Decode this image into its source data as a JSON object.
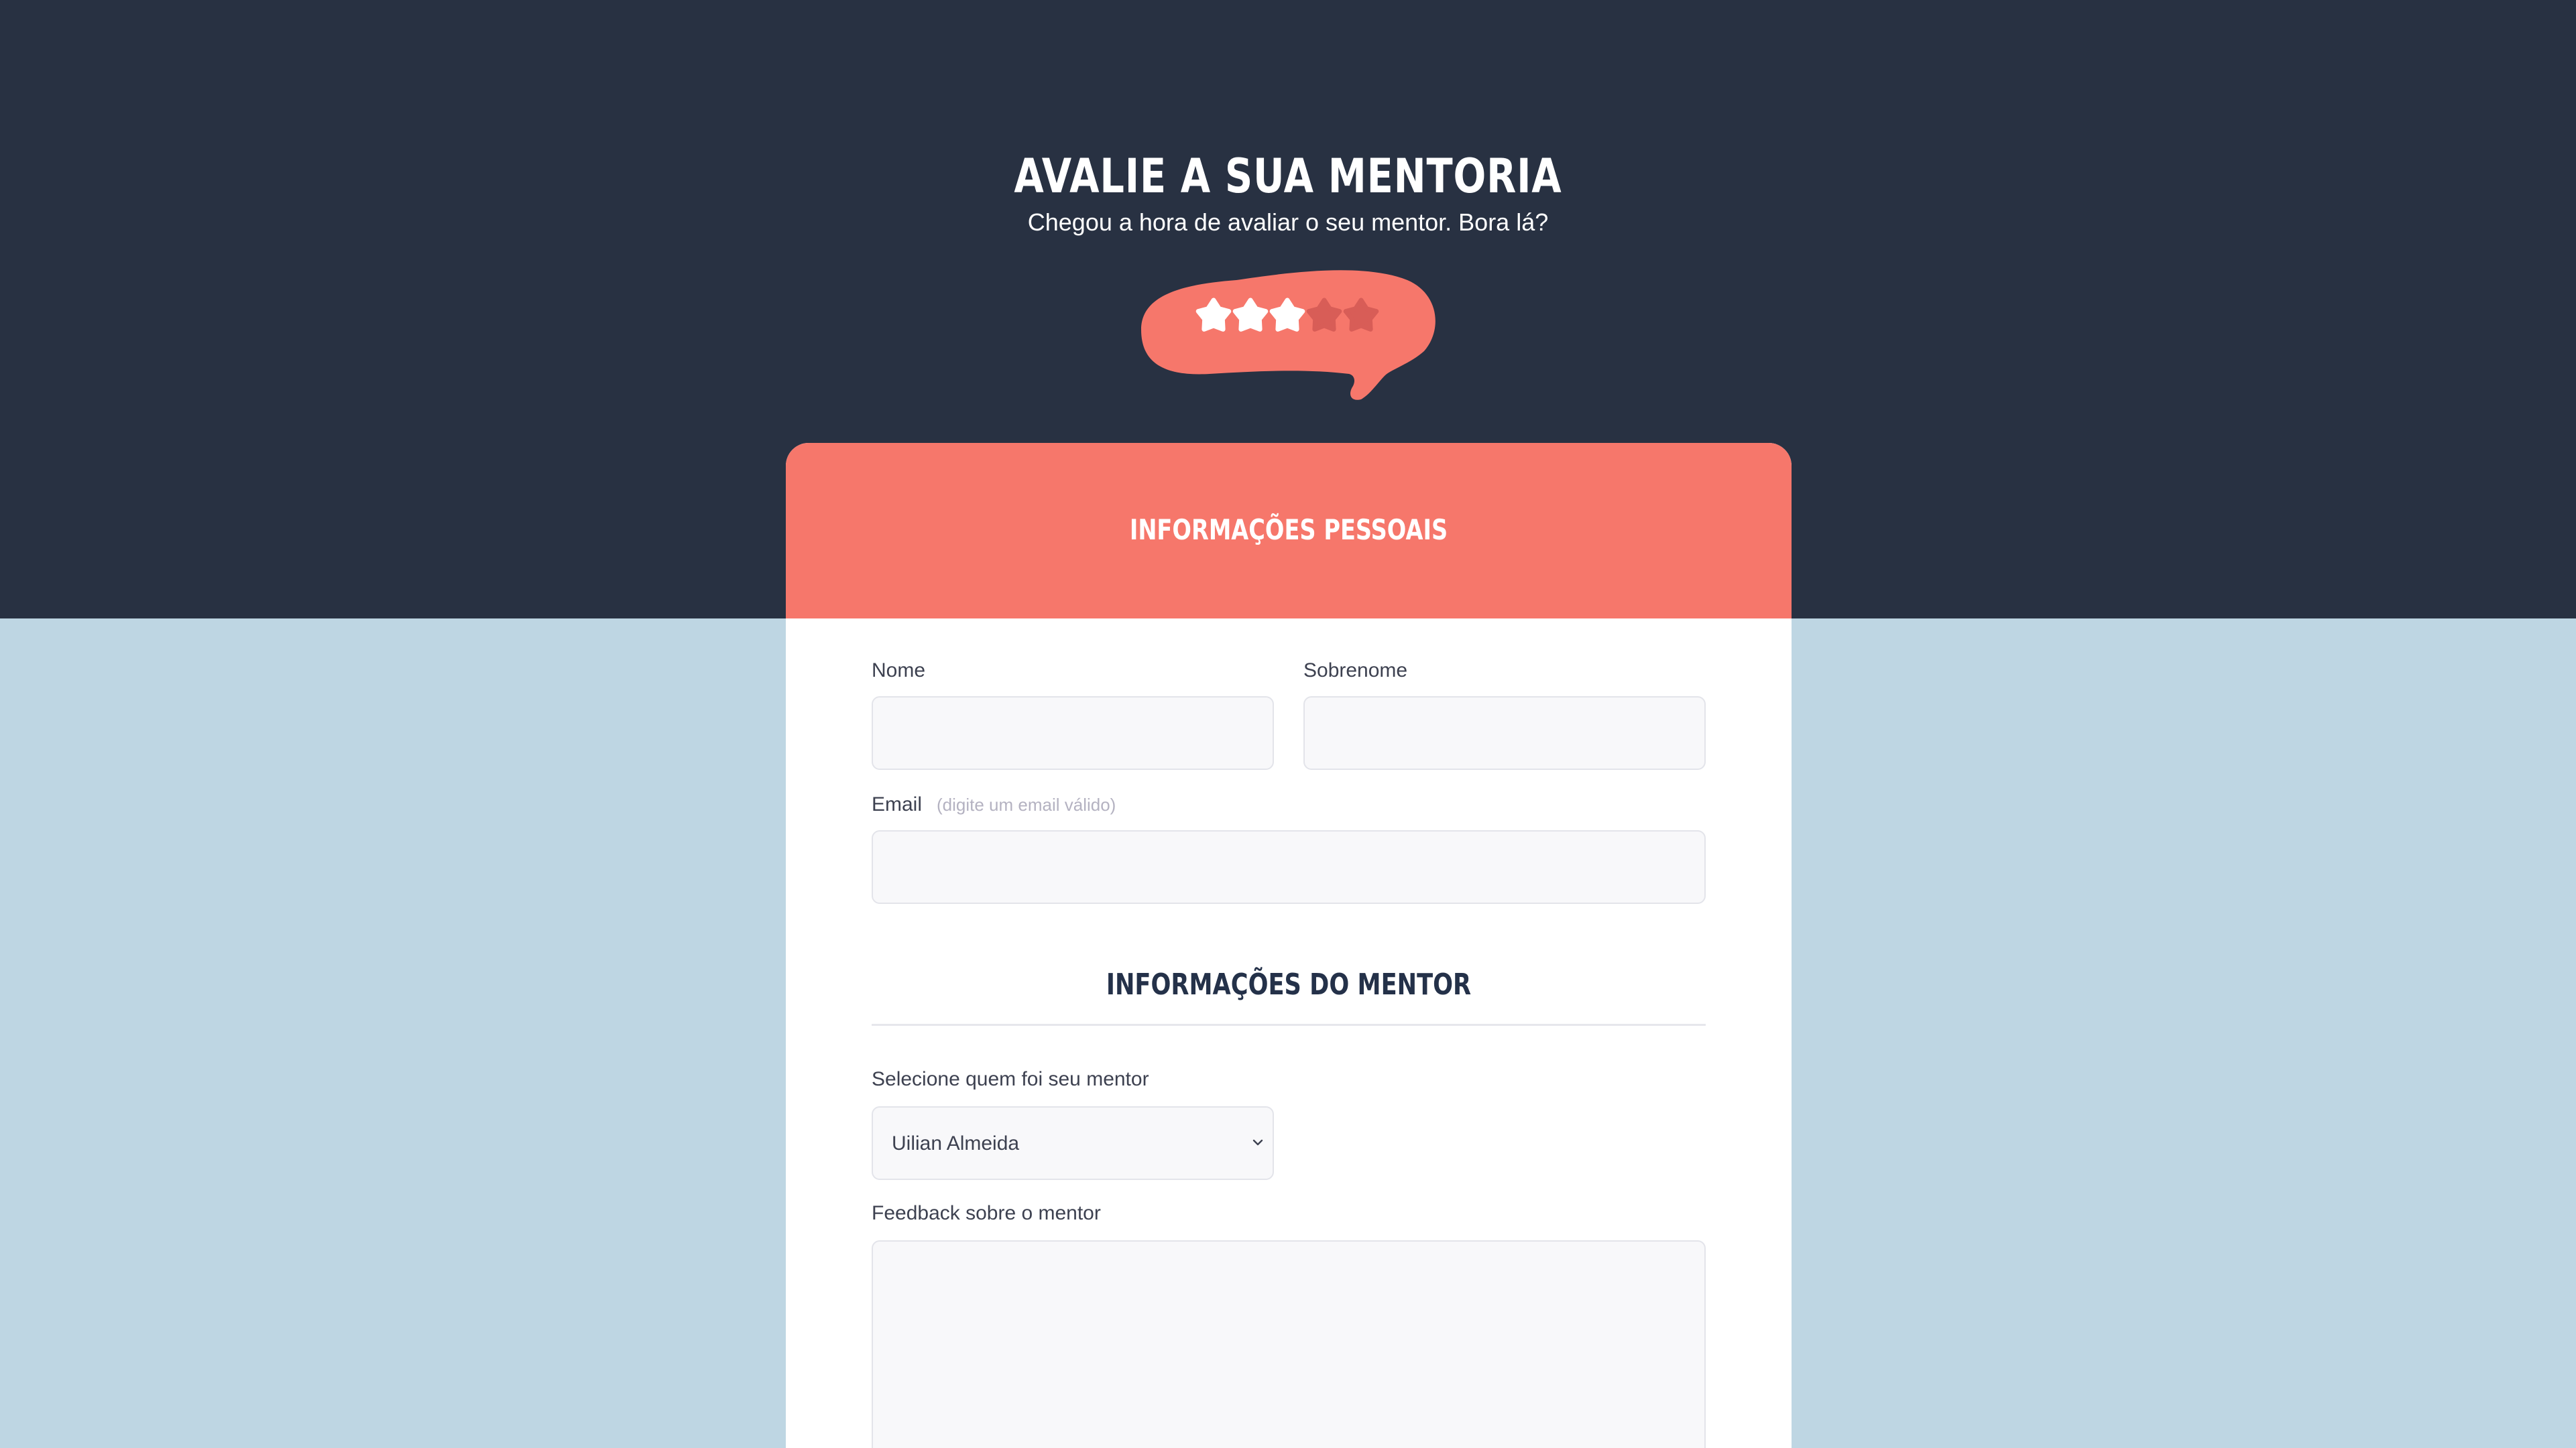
{
  "hero": {
    "title": "AVALIE A SUA MENTORIA",
    "subtitle": "Chegou a hora de avaliar o seu mentor. Bora lá?",
    "rating": {
      "filled": 3,
      "total": 5
    }
  },
  "colors": {
    "dark_band": "#283142",
    "light_background": "#bed6e3",
    "accent": "#f6776b",
    "star_filled": "#ffffff",
    "star_empty": "#d85d57",
    "section_title": "#243149"
  },
  "personal_section": {
    "title": "INFORMAÇÕES PESSOAIS",
    "first_name": {
      "label": "Nome",
      "value": ""
    },
    "last_name": {
      "label": "Sobrenome",
      "value": ""
    },
    "email": {
      "label": "Email",
      "hint": "(digite um email válido)",
      "value": ""
    }
  },
  "mentor_section": {
    "title": "INFORMAÇÕES DO MENTOR",
    "mentor_select": {
      "label": "Selecione quem foi seu mentor",
      "selected": "Uilian Almeida"
    },
    "feedback": {
      "label": "Feedback sobre o mentor",
      "value": ""
    }
  },
  "icons": {
    "rating_star": "star-icon",
    "select_caret": "chevron-down-icon"
  }
}
